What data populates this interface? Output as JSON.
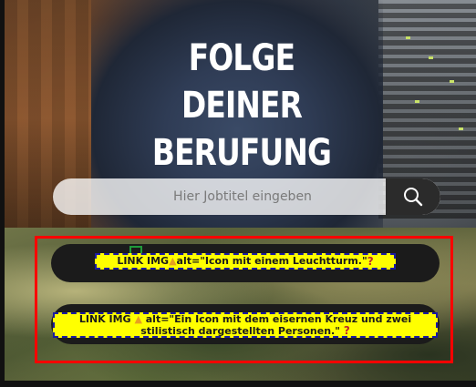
{
  "hero": {
    "headline_line1": "FOLGE DEINER",
    "headline_line2": "BERUFUNG"
  },
  "search": {
    "placeholder": "Hier Jobtitel eingeben",
    "button_icon": "search-icon"
  },
  "links": [
    {
      "prefix": "LINK IMG",
      "icon": "thumbs-up-icon",
      "alt_text": "alt=\"Icon mit einem Leuchtturm.\"",
      "suffix_icon": "question-mark-icon"
    },
    {
      "prefix": "LINK IMG",
      "icon": "thumbs-up-icon",
      "alt_text_line1": "alt=\"Ein Icon mit dem eisernen Kreuz und zwei",
      "alt_text_line2": "stilistisch dargestellten Personen.\"",
      "suffix_icon": "question-mark-icon"
    }
  ],
  "colors": {
    "highlight": "#ff0000",
    "alt_tag_background": "#ffff00",
    "pill_background": "#1b1b1b",
    "search_button": "#2b2b2b"
  }
}
